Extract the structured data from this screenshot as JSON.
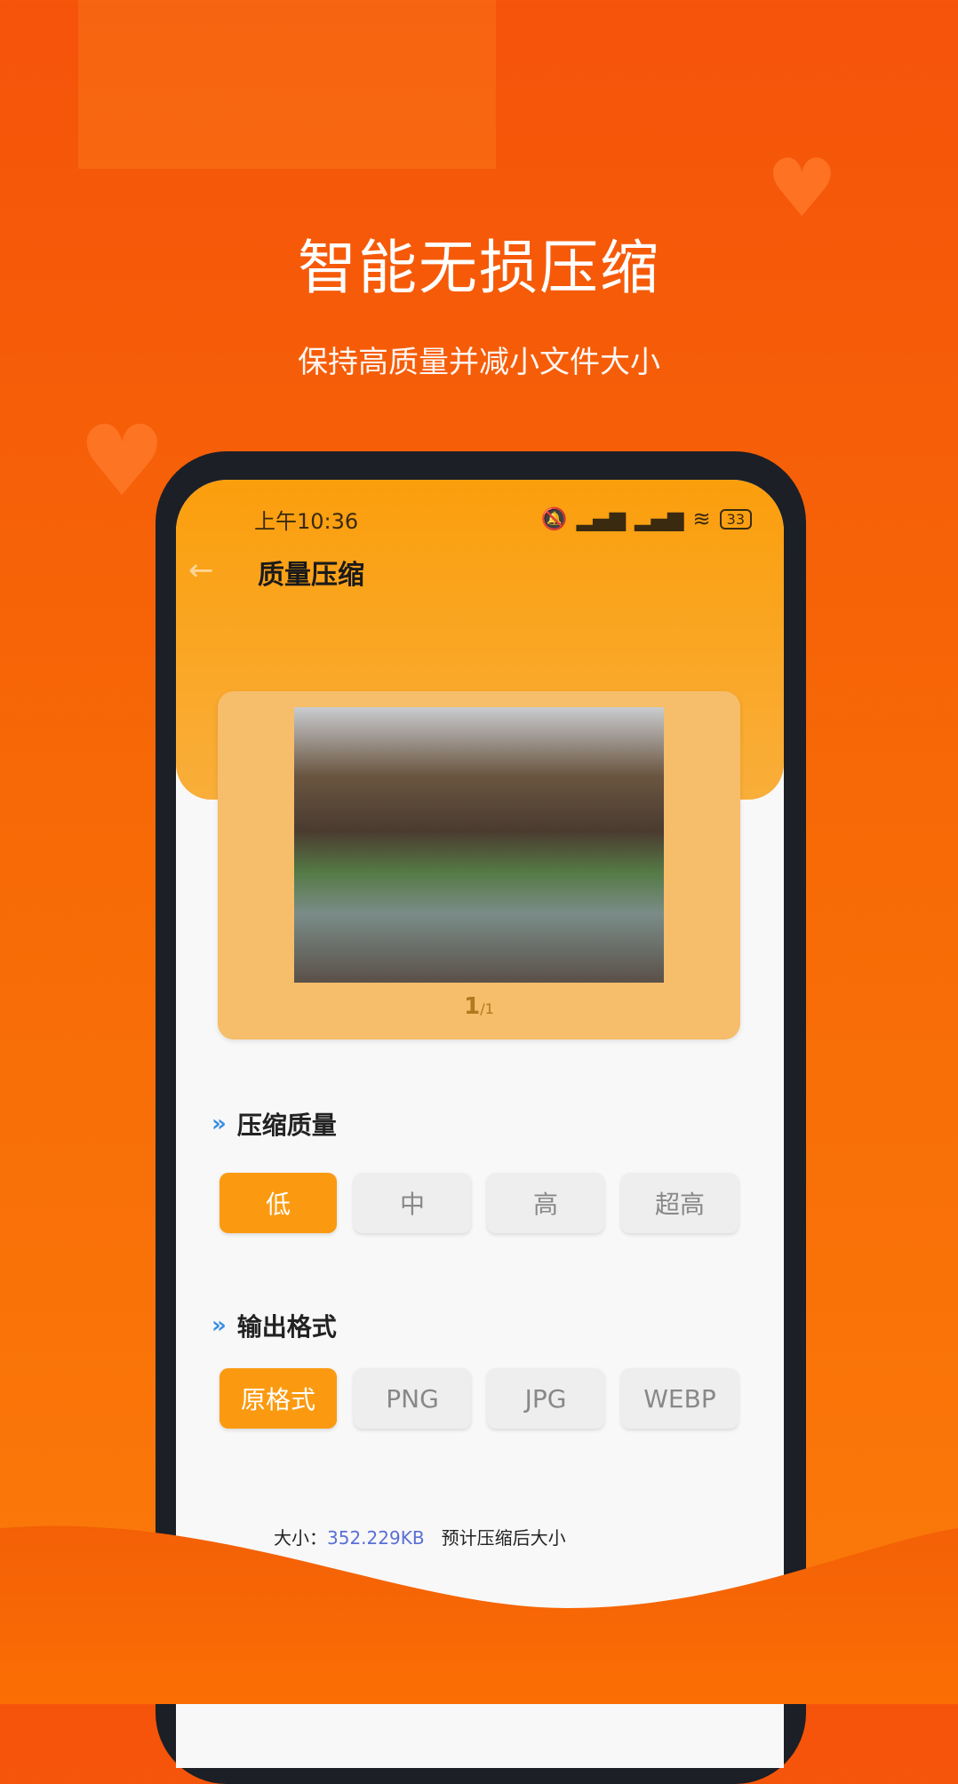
{
  "hero": {
    "title": "智能无损压缩",
    "subtitle": "保持高质量并减小文件大小"
  },
  "status_bar": {
    "time": "上午10:36",
    "battery": "33",
    "icons": [
      "mute-icon",
      "signal-icon",
      "hd-signal-icon",
      "wifi-icon",
      "battery-icon"
    ]
  },
  "header": {
    "title": "质量压缩",
    "back_icon": "arrow-left-icon"
  },
  "preview": {
    "current": "1",
    "total": "/1"
  },
  "quality": {
    "label": "压缩质量",
    "options": [
      "低",
      "中",
      "高",
      "超高"
    ],
    "selected": "低"
  },
  "format": {
    "label": "输出格式",
    "options": [
      "原格式",
      "PNG",
      "JPG",
      "WEBP"
    ],
    "selected": "原格式"
  },
  "size_info": {
    "original_label": "大小：",
    "original_value": "352.229KB",
    "estimated_label": "预计压缩后大小"
  },
  "colors": {
    "accent": "#fb9a10",
    "background": "#f5530a",
    "link": "#5a6fd6"
  }
}
